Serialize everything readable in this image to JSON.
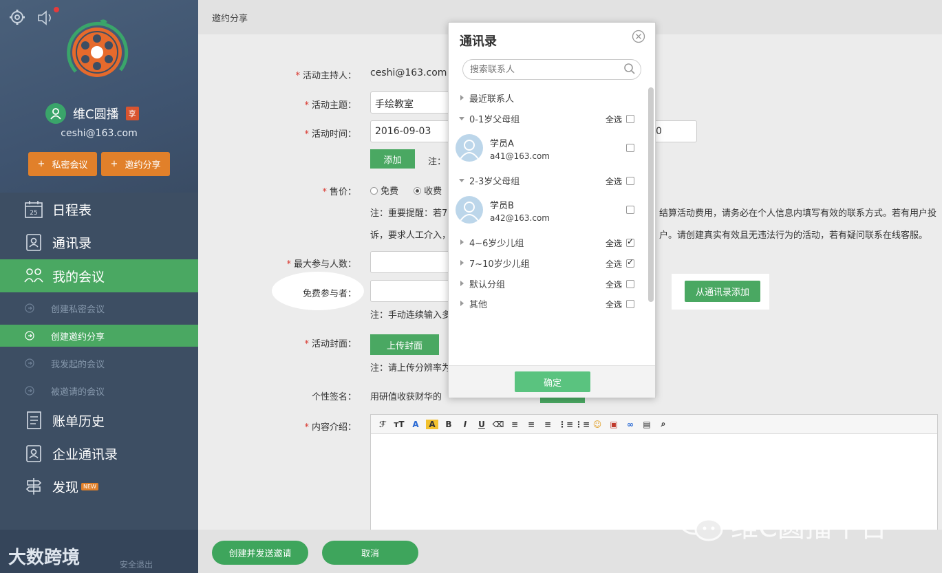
{
  "sidebar": {
    "user_name": "维C圆播",
    "user_badge": "享",
    "email": "ceshi@163.com",
    "btn_private": "私密会议",
    "btn_invite": "邀约分享",
    "plus": "+",
    "nav": [
      "日程表",
      "通讯录",
      "我的会议",
      "账单历史",
      "企业通讯录",
      "发现"
    ],
    "new_badge": "NEW",
    "sub": [
      "创建私密会议",
      "创建邀约分享",
      "我发起的会议",
      "被邀请的会议"
    ],
    "bottom_left": "大数跨境",
    "bottom_right": "安全退出"
  },
  "main": {
    "breadcrumb": "邀约分享",
    "req": "*",
    "labels": {
      "host": "活动主持人：",
      "topic": "活动主题：",
      "time": "活动时间：",
      "price": "售价：",
      "max": "最大参与人数：",
      "free": "免费参与者：",
      "cover": "活动封面：",
      "sign": "个性签名：",
      "intro": "内容介绍："
    },
    "host_value": "ceshi@163.com",
    "topic_value": "手绘教室",
    "date_value": "2016-09-03",
    "time_end_fragment": "0",
    "add_btn": "添加",
    "add_note": "注：",
    "price_free": "免费",
    "price_paid": "收费",
    "price_note1_a": "注：重要提醒：若7",
    "price_note1_b": "结算活动费用，请务必在个人信息内填写有效的联系方式。若有用户投",
    "price_note2_a": "诉，要求人工介入，",
    "price_note2_b": "户。请创建真实有效且无违法行为的活动，若有疑问联系在线客服。",
    "free_note": "注：手动连续输入多",
    "from_contacts_btn": "从通讯录添加",
    "upload_btn": "上传封面",
    "cover_note": "注：请上传分辨率为",
    "sign_value": "用研值收获财华的",
    "submit_btn": "创建并发送邀请",
    "cancel_btn": "取消",
    "watermark": "维C圆播平台",
    "toolbar": [
      "ℱ",
      "тT",
      "A",
      "A",
      "B",
      "I",
      "U",
      "⌫",
      "≡",
      "≡",
      "≡",
      "⋮≡",
      "⋮≡",
      "☺",
      "▣",
      "∞",
      "▤",
      "⌕"
    ]
  },
  "modal": {
    "title": "通讯录",
    "search_placeholder": "搜索联系人",
    "recent": "最近联系人",
    "select_all": "全选",
    "groups": [
      {
        "name": "0-1岁父母组",
        "checked": false
      },
      {
        "name": "2-3岁父母组",
        "checked": false
      },
      {
        "name": "4~6岁少儿组",
        "checked": true
      },
      {
        "name": "7~10岁少儿组",
        "checked": true
      },
      {
        "name": "默认分组",
        "checked": false
      },
      {
        "name": "其他",
        "checked": false
      }
    ],
    "members": [
      {
        "name": "学员A",
        "email": "a41@163.com"
      },
      {
        "name": "学员B",
        "email": "a42@163.com"
      }
    ],
    "confirm": "确定"
  },
  "colors": {
    "green": "#4aa862",
    "orange": "#e1802a",
    "sidebar": "#3d4e63"
  }
}
